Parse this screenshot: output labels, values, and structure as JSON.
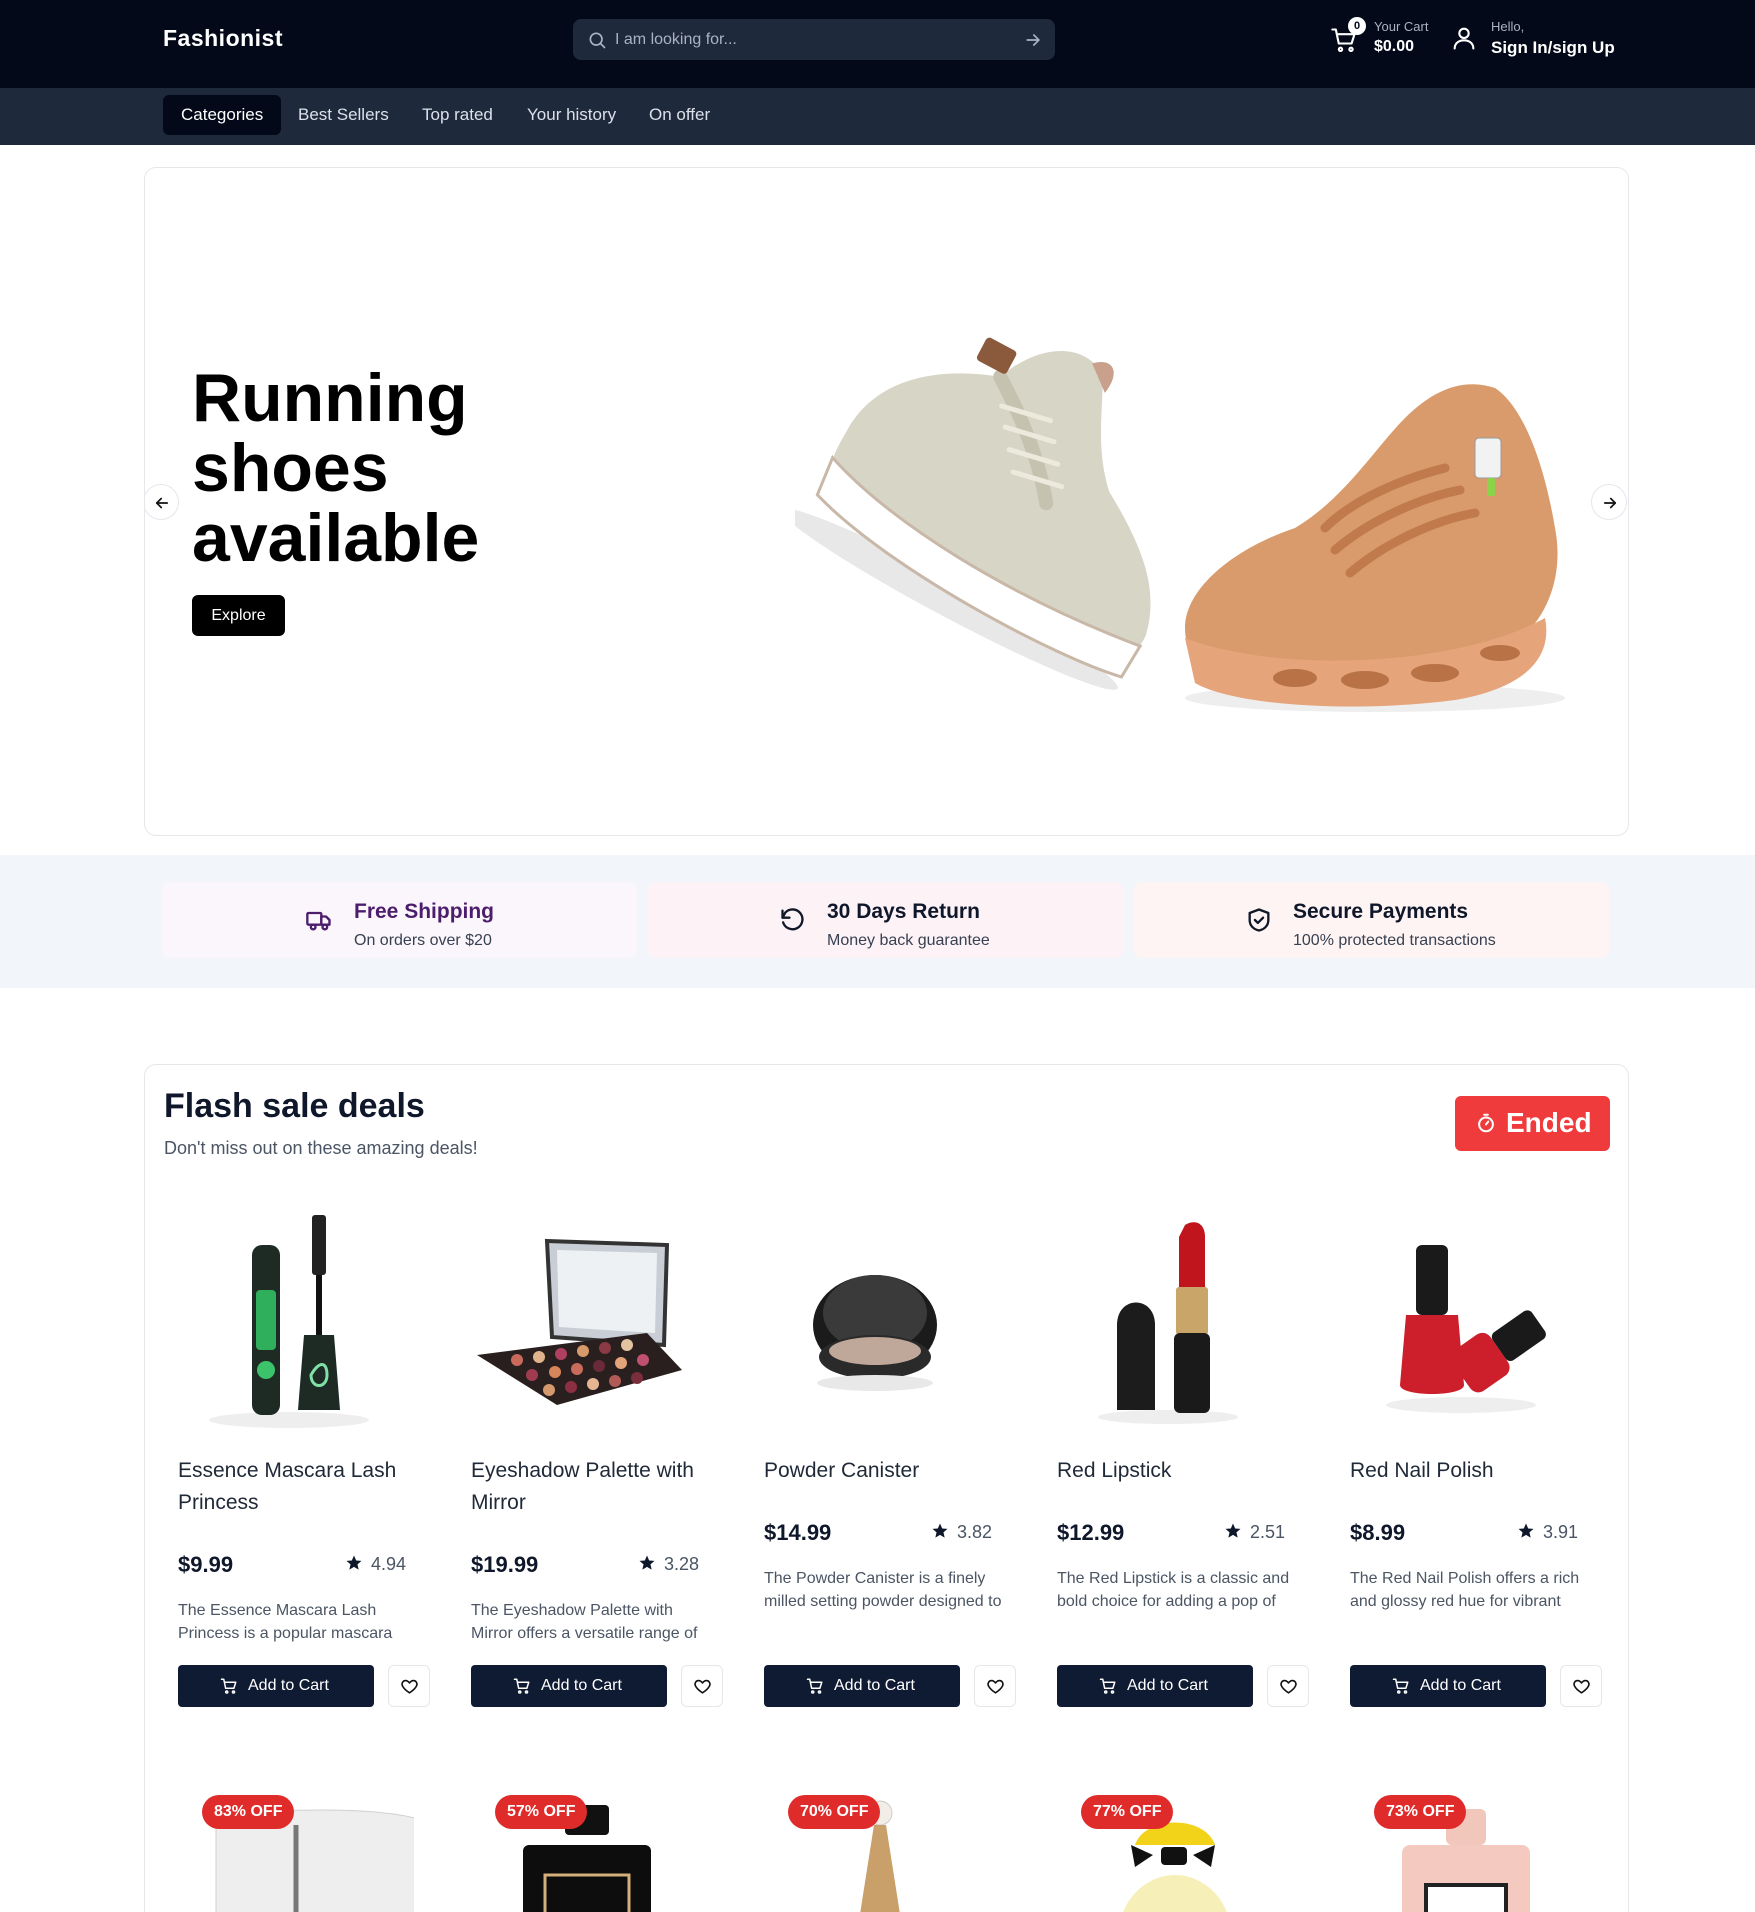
{
  "header": {
    "brand": "Fashionist",
    "search_placeholder": "I am looking for...",
    "cart": {
      "count": "0",
      "label": "Your Cart",
      "amount": "$0.00"
    },
    "account": {
      "greeting": "Hello,",
      "action": "Sign In/sign Up"
    }
  },
  "nav": {
    "items": [
      {
        "label": "Categories",
        "active": true
      },
      {
        "label": "Best Sellers"
      },
      {
        "label": "Top rated"
      },
      {
        "label": "Your history"
      },
      {
        "label": "On offer"
      }
    ]
  },
  "hero": {
    "title": "Running shoes available",
    "cta": "Explore"
  },
  "features": [
    {
      "title": "Free Shipping",
      "subtitle": "On orders over $20",
      "icon": "truck-icon",
      "bg": "#fbf6fc",
      "color": "#4c1d6b"
    },
    {
      "title": "30 Days Return",
      "subtitle": "Money back guarantee",
      "icon": "rotate-ccw-icon",
      "bg": "#fdf2f6",
      "color": "#111827"
    },
    {
      "title": "Secure Payments",
      "subtitle": "100% protected transactions",
      "icon": "shield-check-icon",
      "bg": "#fff4f4",
      "color": "#111827"
    }
  ],
  "flash": {
    "title": "Flash sale deals",
    "subtitle": "Don't miss out on these amazing deals!",
    "status": "Ended",
    "add_label": "Add to Cart",
    "products": [
      {
        "name": "Essence Mascara Lash Princess",
        "price": "$9.99",
        "rating": "4.94",
        "description": "The Essence Mascara Lash Princess is a popular mascara known for its volumizing and lengthening effects."
      },
      {
        "name": "Eyeshadow Palette with Mirror",
        "price": "$19.99",
        "rating": "3.28",
        "description": "The Eyeshadow Palette with Mirror offers a versatile range of eyeshadow shades for creating stunning eye looks."
      },
      {
        "name": "Powder Canister",
        "price": "$14.99",
        "rating": "3.82",
        "description": "The Powder Canister is a finely milled setting powder designed to set makeup."
      },
      {
        "name": "Red Lipstick",
        "price": "$12.99",
        "rating": "2.51",
        "description": "The Red Lipstick is a classic and bold choice for adding a pop of color to your lips."
      },
      {
        "name": "Red Nail Polish",
        "price": "$8.99",
        "rating": "3.91",
        "description": "The Red Nail Polish offers a rich and glossy red hue for vibrant and polished nails."
      }
    ],
    "discounts": [
      "83% OFF",
      "57% OFF",
      "70% OFF",
      "77% OFF",
      "73% OFF"
    ]
  },
  "colors": {
    "header_bg": "#030918",
    "nav_bg": "#1e293b",
    "button_dark": "#0f1a33",
    "ended_red": "#ef3b3b",
    "discount_red": "#e02b2b"
  }
}
